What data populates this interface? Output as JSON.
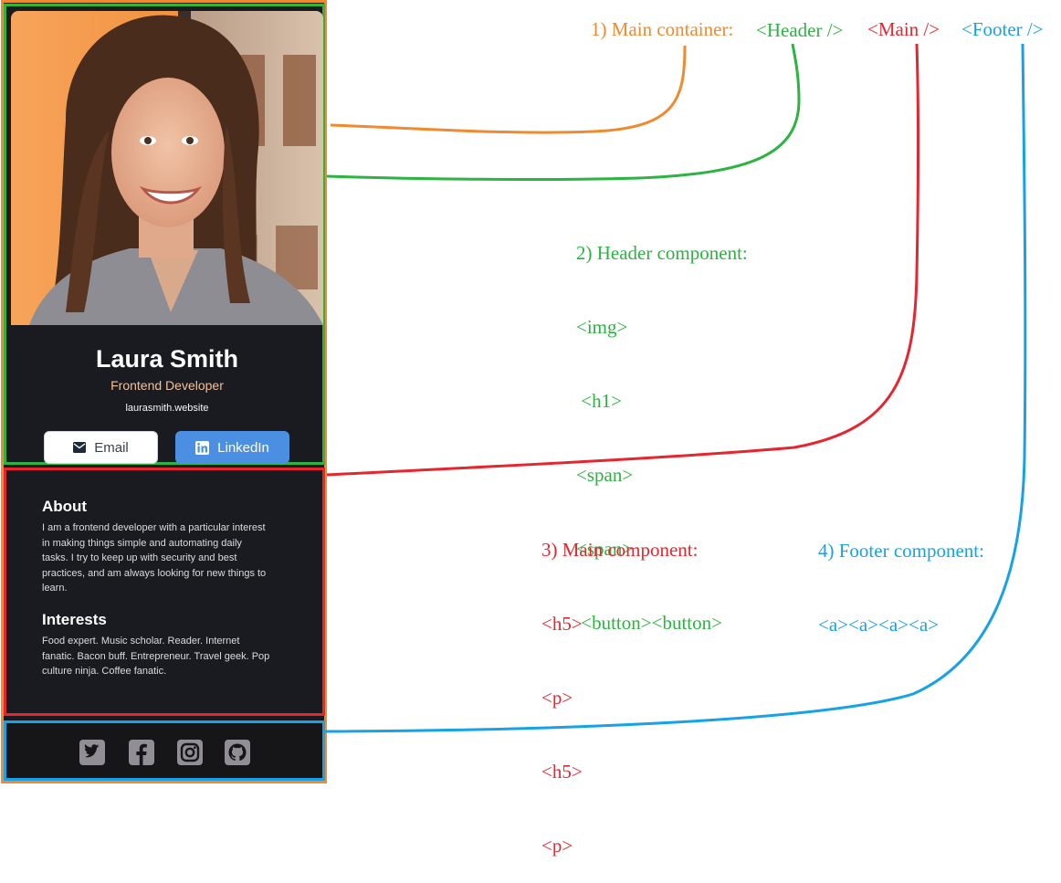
{
  "card": {
    "name": "Laura Smith",
    "title": "Frontend Developer",
    "website": "laurasmith.website",
    "buttons": {
      "email": "Email",
      "linkedin": "LinkedIn"
    },
    "about_title": "About",
    "about_lines": [
      "I am a frontend developer with a particular interest",
      "in making things simple and automating daily",
      "tasks. I try to keep up with security and best",
      "practices, and am always looking for new things to",
      "learn."
    ],
    "interests_title": "Interests",
    "interests_lines": [
      "Food expert. Music scholar. Reader. Internet",
      "fanatic. Bacon buff. Entrepreneur. Travel geek. Pop",
      "culture ninja. Coffee fanatic."
    ],
    "social_icons": [
      "twitter-icon",
      "facebook-icon",
      "instagram-icon",
      "github-icon"
    ]
  },
  "annotations": {
    "main_container": {
      "label": "1) Main container:",
      "header_tag": "<Header />",
      "main_tag": "<Main />",
      "footer_tag": "<Footer />"
    },
    "header_component": {
      "label": "2) Header component:",
      "lines": [
        "<img>",
        " <h1>",
        "<span>",
        "<span>",
        " <button><button>"
      ]
    },
    "main_component": {
      "label": "3) Main component:",
      "lines": [
        "<h5>",
        "<p>",
        "<h5>",
        "<p>"
      ]
    },
    "footer_component": {
      "label": "4) Footer component:",
      "line": "<a><a><a><a>"
    }
  },
  "colors": {
    "main": "#f08a2f",
    "header": "#2cb341",
    "main_component": "#e5262e",
    "footer": "#17a1e6",
    "card_bg": "#1a1b21",
    "linkedin": "#4a8fe2"
  }
}
